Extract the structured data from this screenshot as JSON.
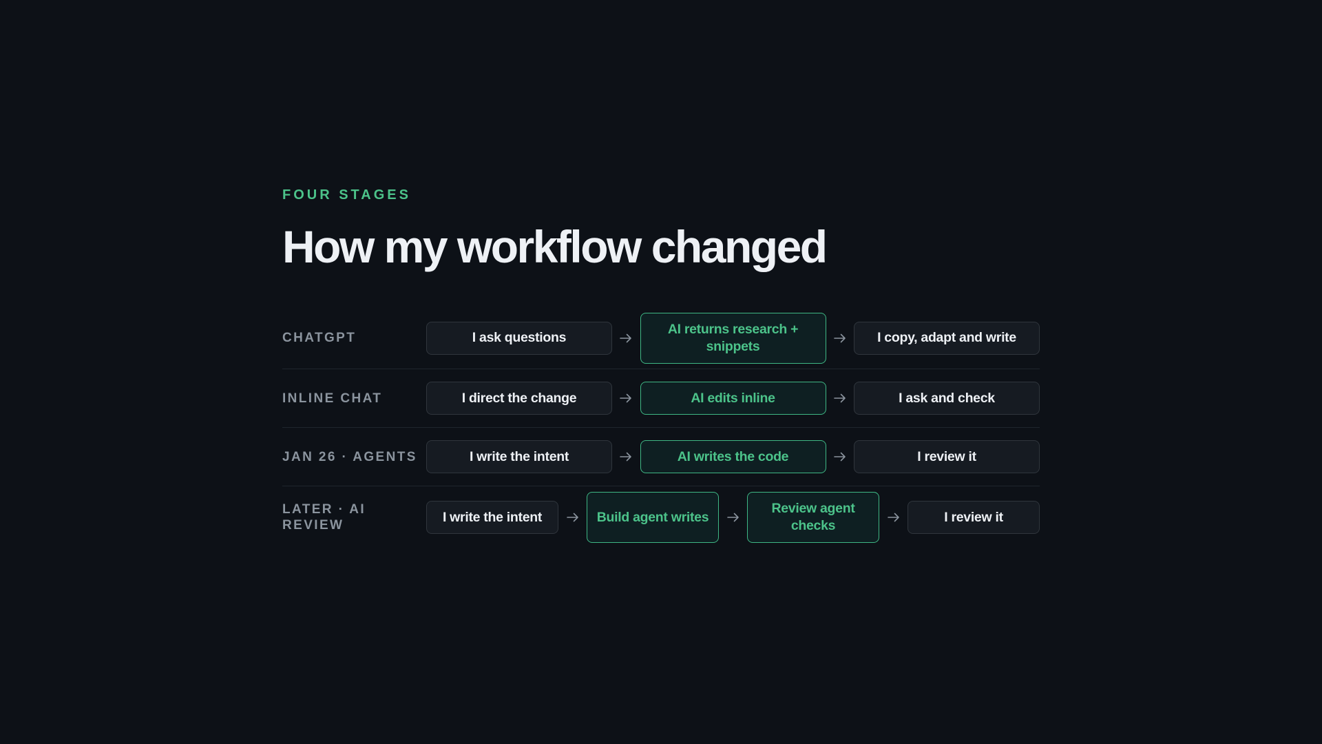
{
  "header": {
    "eyebrow": "FOUR STAGES",
    "title": "How my workflow changed"
  },
  "colors": {
    "background": "#0d1117",
    "accent": "#4cc38a",
    "ai_border": "#3fb885",
    "human_border": "#30363d",
    "label": "#8b949e",
    "text": "#eef1f5"
  },
  "stages": [
    {
      "label": "CHATGPT",
      "steps": [
        {
          "text": "I ask questions",
          "kind": "human"
        },
        {
          "text": "AI returns research + snippets",
          "kind": "ai"
        },
        {
          "text": "I copy, adapt and write",
          "kind": "human"
        }
      ]
    },
    {
      "label": "INLINE CHAT",
      "steps": [
        {
          "text": "I direct the change",
          "kind": "human"
        },
        {
          "text": "AI edits inline",
          "kind": "ai"
        },
        {
          "text": "I ask and check",
          "kind": "human"
        }
      ]
    },
    {
      "label": "JAN 26 · AGENTS",
      "steps": [
        {
          "text": "I write the intent",
          "kind": "human"
        },
        {
          "text": "AI writes the code",
          "kind": "ai"
        },
        {
          "text": "I review it",
          "kind": "human"
        }
      ]
    },
    {
      "label": "LATER · AI REVIEW",
      "steps": [
        {
          "text": "I write the intent",
          "kind": "human"
        },
        {
          "text": "Build agent writes",
          "kind": "ai"
        },
        {
          "text": "Review agent checks",
          "kind": "ai"
        },
        {
          "text": "I review it",
          "kind": "human"
        }
      ]
    }
  ],
  "icons": {
    "connector": "arrow-right-icon"
  }
}
